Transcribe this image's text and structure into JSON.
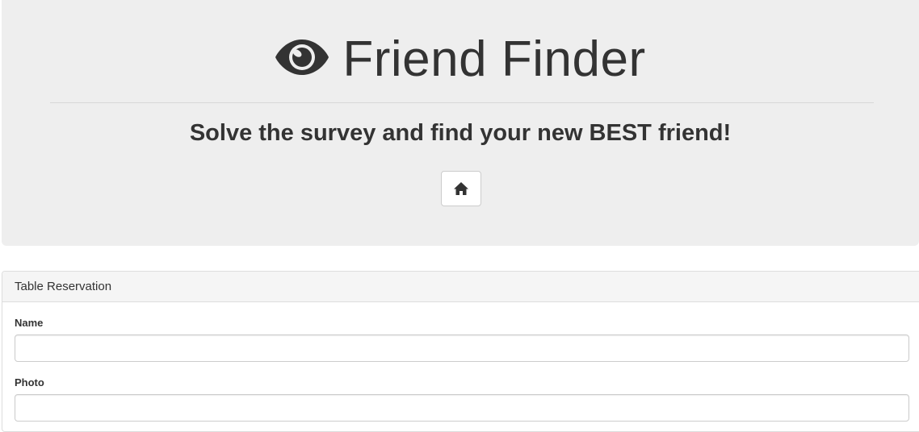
{
  "header": {
    "title": "Friend Finder",
    "title_icon": "eye-icon",
    "subtitle": "Solve the survey and find your new BEST friend!",
    "home_button": {
      "icon": "home-icon",
      "label": ""
    }
  },
  "panel": {
    "heading": "Table Reservation",
    "fields": [
      {
        "label": "Name",
        "value": "",
        "placeholder": ""
      },
      {
        "label": "Photo",
        "value": "",
        "placeholder": ""
      }
    ]
  },
  "colors": {
    "jumbotron_bg": "#eeeeee",
    "text": "#333333",
    "panel_heading_bg": "#f5f5f5",
    "border": "#cccccc"
  }
}
